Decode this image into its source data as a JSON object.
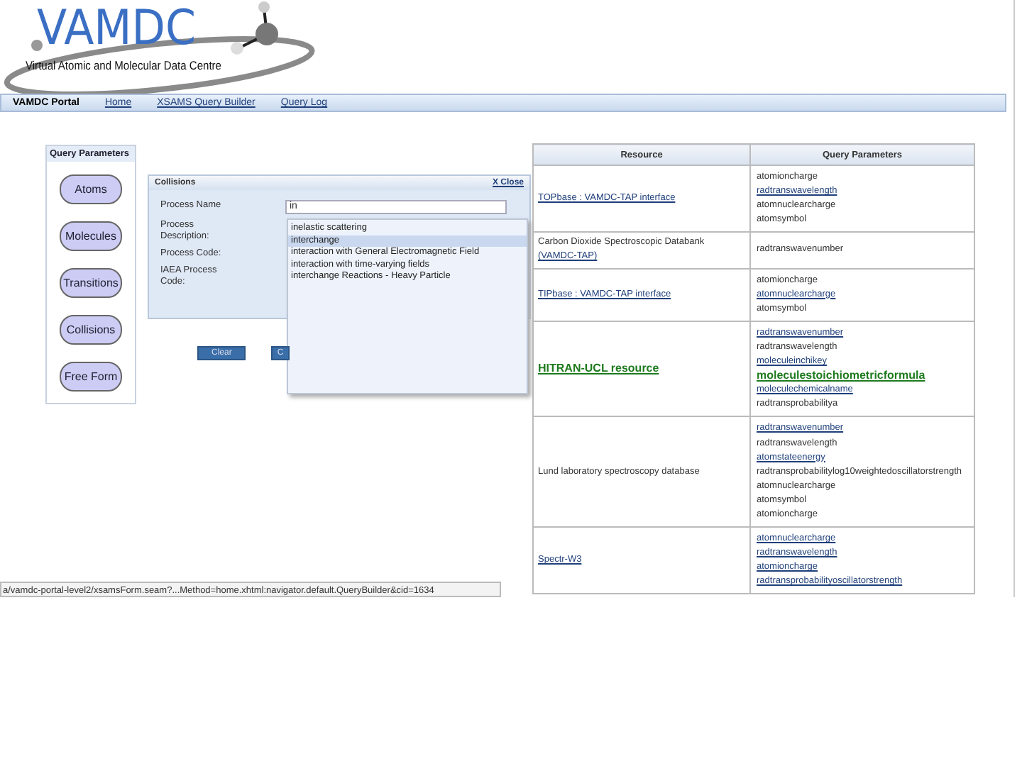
{
  "logo": {
    "title": "VAMDC",
    "subtitle": "Virtual Atomic and Molecular Data Centre"
  },
  "nav": [
    {
      "label": "VAMDC Portal",
      "kind": "brand"
    },
    {
      "label": "Home",
      "kind": "link"
    },
    {
      "label": "XSAMS Query Builder",
      "kind": "link"
    },
    {
      "label": "Query Log",
      "kind": "link"
    }
  ],
  "query_panel": {
    "title": "Query Parameters",
    "buttons": [
      "Atoms",
      "Molecules",
      "Transitions",
      "Collisions",
      "Free Form"
    ]
  },
  "dialog": {
    "title": "Collisions",
    "close": "X Close",
    "fields": [
      {
        "label": "Process Name",
        "kind": "input",
        "value": "in"
      },
      {
        "label": "Process Description:",
        "kind": "label"
      },
      {
        "label": "Process Code:",
        "kind": "label"
      },
      {
        "label": "IAEA Process Code:",
        "kind": "label"
      }
    ],
    "buttons": [
      "Clear",
      "C"
    ]
  },
  "suggestions": [
    {
      "label": "inelastic scattering",
      "selected": false
    },
    {
      "label": "interchange",
      "selected": true
    },
    {
      "label": "interaction with General Electromagnetic Field",
      "selected": false
    },
    {
      "label": "interaction with time-varying fields",
      "selected": false
    },
    {
      "label": "interchange Reactions - Heavy Particle",
      "selected": false
    }
  ],
  "table": {
    "columns": [
      "Resource",
      "Query Parameters"
    ],
    "rows": [
      {
        "resource": [
          {
            "text": "TOPbase : VAMDC-TAP interface",
            "kind": "link"
          }
        ],
        "params": [
          {
            "text": "atomioncharge",
            "kind": "plain"
          },
          {
            "text": "radtranswavelength",
            "kind": "link"
          },
          {
            "text": "atomnuclearcharge",
            "kind": "plain"
          },
          {
            "text": "atomsymbol",
            "kind": "plain"
          }
        ]
      },
      {
        "resource": [
          {
            "text": "Carbon Dioxide Spectroscopic Databank",
            "kind": "plain"
          },
          {
            "text": "(VAMDC-TAP)",
            "kind": "link"
          }
        ],
        "params": [
          {
            "text": "radtranswavenumber",
            "kind": "plain"
          }
        ]
      },
      {
        "resource": [
          {
            "text": "TIPbase : VAMDC-TAP interface",
            "kind": "link"
          }
        ],
        "params": [
          {
            "text": "atomioncharge",
            "kind": "plain"
          },
          {
            "text": "atomnuclearcharge",
            "kind": "link"
          },
          {
            "text": "atomsymbol",
            "kind": "plain"
          }
        ]
      },
      {
        "resource": [
          {
            "text": "HITRAN-UCL resource",
            "kind": "highlight"
          }
        ],
        "params": [
          {
            "text": "radtranswavenumber",
            "kind": "link"
          },
          {
            "text": "radtranswavelength",
            "kind": "plain"
          },
          {
            "text": "moleculeinchikey",
            "kind": "link"
          },
          {
            "text": "moleculestoichiometricformula",
            "kind": "highlight"
          },
          {
            "text": "moleculechemicalname",
            "kind": "link"
          },
          {
            "text": "radtransprobabilitya",
            "kind": "plain"
          }
        ]
      },
      {
        "resource": [
          {
            "text": "Lund laboratory spectroscopy database",
            "kind": "plain"
          }
        ],
        "params": [
          {
            "text": "radtranswavenumber",
            "kind": "link"
          },
          {
            "text": "radtranswavelength",
            "kind": "plain"
          },
          {
            "text": "atomstateenergy",
            "kind": "link"
          },
          {
            "text": "radtransprobabilitylog10weightedoscillatorstrength",
            "kind": "plain"
          },
          {
            "text": "atomnuclearcharge",
            "kind": "plain"
          },
          {
            "text": "atomsymbol",
            "kind": "plain"
          },
          {
            "text": "atomioncharge",
            "kind": "plain"
          }
        ]
      },
      {
        "resource": [
          {
            "text": "Spectr-W3",
            "kind": "link"
          }
        ],
        "params": [
          {
            "text": "atomnuclearcharge",
            "kind": "link"
          },
          {
            "text": "radtranswavelength",
            "kind": "link"
          },
          {
            "text": "atomioncharge",
            "kind": "link"
          },
          {
            "text": "radtransprobabilityoscillatorstrength",
            "kind": "link"
          }
        ]
      }
    ]
  },
  "status_bar": "a/vamdc-portal-level2/xsamsForm.seam?...Method=home.xhtml:navigator.default.QueryBuilder&cid=1634"
}
